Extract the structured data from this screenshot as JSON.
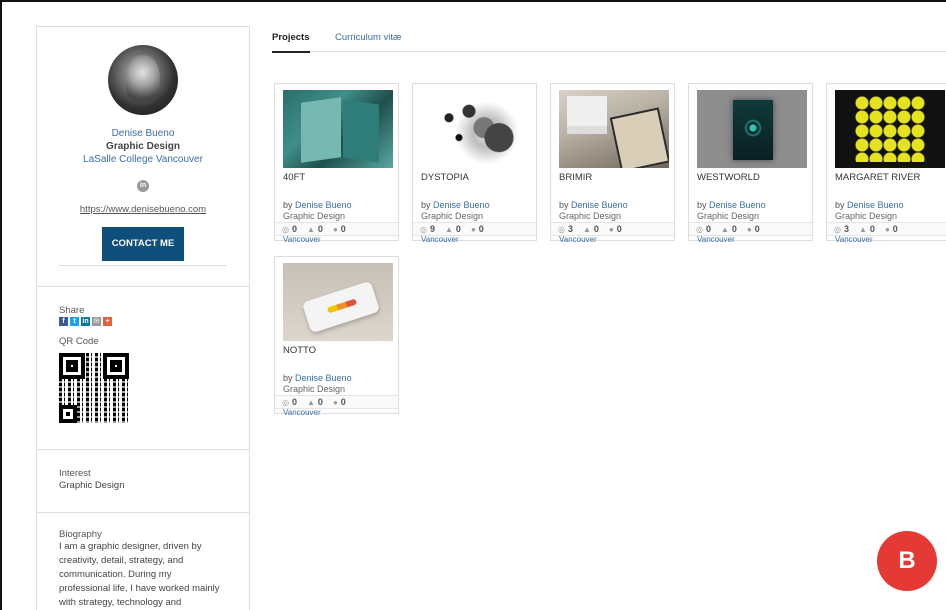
{
  "profile": {
    "name": "Denise Bueno",
    "role": "Graphic Design",
    "school": "LaSalle College Vancouver",
    "url": "https://www.denisebueno.com",
    "contact_label": "CONTACT ME"
  },
  "share": {
    "label": "Share",
    "icons": [
      "facebook-icon",
      "twitter-icon",
      "linkedin-icon",
      "email-icon",
      "plus-icon"
    ]
  },
  "qr": {
    "label": "QR Code"
  },
  "interest": {
    "label": "Interest",
    "value": "Graphic Design"
  },
  "biography": {
    "label": "Biography",
    "lines": [
      "I am a graphic designer, driven by",
      "creativity, detail, strategy, and",
      "communication. During my",
      "professional life, I have worked mainly",
      "with strategy, technology and"
    ]
  },
  "tabs": [
    "Projects",
    "Curriculum vitæ"
  ],
  "projects": [
    {
      "title": "40FT",
      "by_prefix": "by",
      "author": "Denise Bueno",
      "category": "Graphic Design",
      "views": "0",
      "likes": "0",
      "comments": "0",
      "location": "Vancouver"
    },
    {
      "title": "DYSTOPIA",
      "by_prefix": "by",
      "author": "Denise Bueno",
      "category": "Graphic Design",
      "views": "9",
      "likes": "0",
      "comments": "0",
      "location": "Vancouver"
    },
    {
      "title": "BRIMIR",
      "by_prefix": "by",
      "author": "Denise Bueno",
      "category": "Graphic Design",
      "views": "3",
      "likes": "0",
      "comments": "0",
      "location": "Vancouver"
    },
    {
      "title": "WESTWORLD",
      "by_prefix": "by",
      "author": "Denise Bueno",
      "category": "Graphic Design",
      "views": "0",
      "likes": "0",
      "comments": "0",
      "location": "Vancouver"
    },
    {
      "title": "MARGARET RIVER",
      "by_prefix": "by",
      "author": "Denise Bueno",
      "category": "Graphic Design",
      "views": "3",
      "likes": "0",
      "comments": "0",
      "location": "Vancouver"
    },
    {
      "title": "NOTTO",
      "by_prefix": "by",
      "author": "Denise Bueno",
      "category": "Graphic Design",
      "views": "0",
      "likes": "0",
      "comments": "0",
      "location": "Vancouver"
    }
  ],
  "badge": "B",
  "colors": {
    "accent": "#0f4f7c",
    "link": "#3a6fa8",
    "badge": "#e53935"
  }
}
